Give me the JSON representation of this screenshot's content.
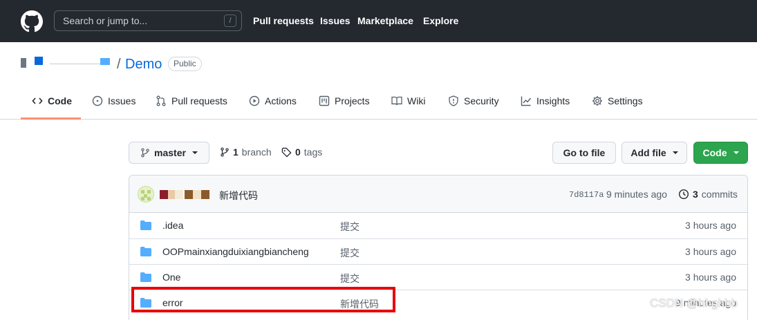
{
  "header": {
    "search_placeholder": "Search or jump to...",
    "slash_key": "/",
    "nav": [
      "Pull requests",
      "Issues",
      "Marketplace",
      "Explore"
    ]
  },
  "repo": {
    "separator": "/",
    "name": "Demo",
    "visibility": "Public"
  },
  "tabs": [
    {
      "label": "Code",
      "icon": "code-icon"
    },
    {
      "label": "Issues",
      "icon": "issue-icon"
    },
    {
      "label": "Pull requests",
      "icon": "pull-request-icon"
    },
    {
      "label": "Actions",
      "icon": "play-icon"
    },
    {
      "label": "Projects",
      "icon": "project-icon"
    },
    {
      "label": "Wiki",
      "icon": "book-icon"
    },
    {
      "label": "Security",
      "icon": "shield-icon"
    },
    {
      "label": "Insights",
      "icon": "graph-icon"
    },
    {
      "label": "Settings",
      "icon": "gear-icon"
    }
  ],
  "toolbar": {
    "branch": "master",
    "branch_count": "1",
    "branch_label": "branch",
    "tag_count": "0",
    "tag_label": "tags",
    "go_to_file": "Go to file",
    "add_file": "Add file",
    "code": "Code"
  },
  "commit": {
    "message": "新增代码",
    "hash": "7d8117a",
    "time": "9 minutes ago",
    "count": "3",
    "count_label": "commits"
  },
  "files": [
    {
      "name": ".idea",
      "message": "提交",
      "time": "3 hours ago"
    },
    {
      "name": "OOPmainxiangduixiangbiancheng",
      "message": "提交",
      "time": "3 hours ago"
    },
    {
      "name": "One",
      "message": "提交",
      "time": "3 hours ago"
    },
    {
      "name": "error",
      "message": "新增代码",
      "time": "9 minutes ago"
    }
  ],
  "watermark": "CSDN @hhghhb",
  "colors": {
    "header_bg": "#24292f",
    "link": "#0969da",
    "green": "#2da44e",
    "folder": "#54aeff",
    "highlight": "#e8000b",
    "tab_underline": "#fd8c73"
  }
}
